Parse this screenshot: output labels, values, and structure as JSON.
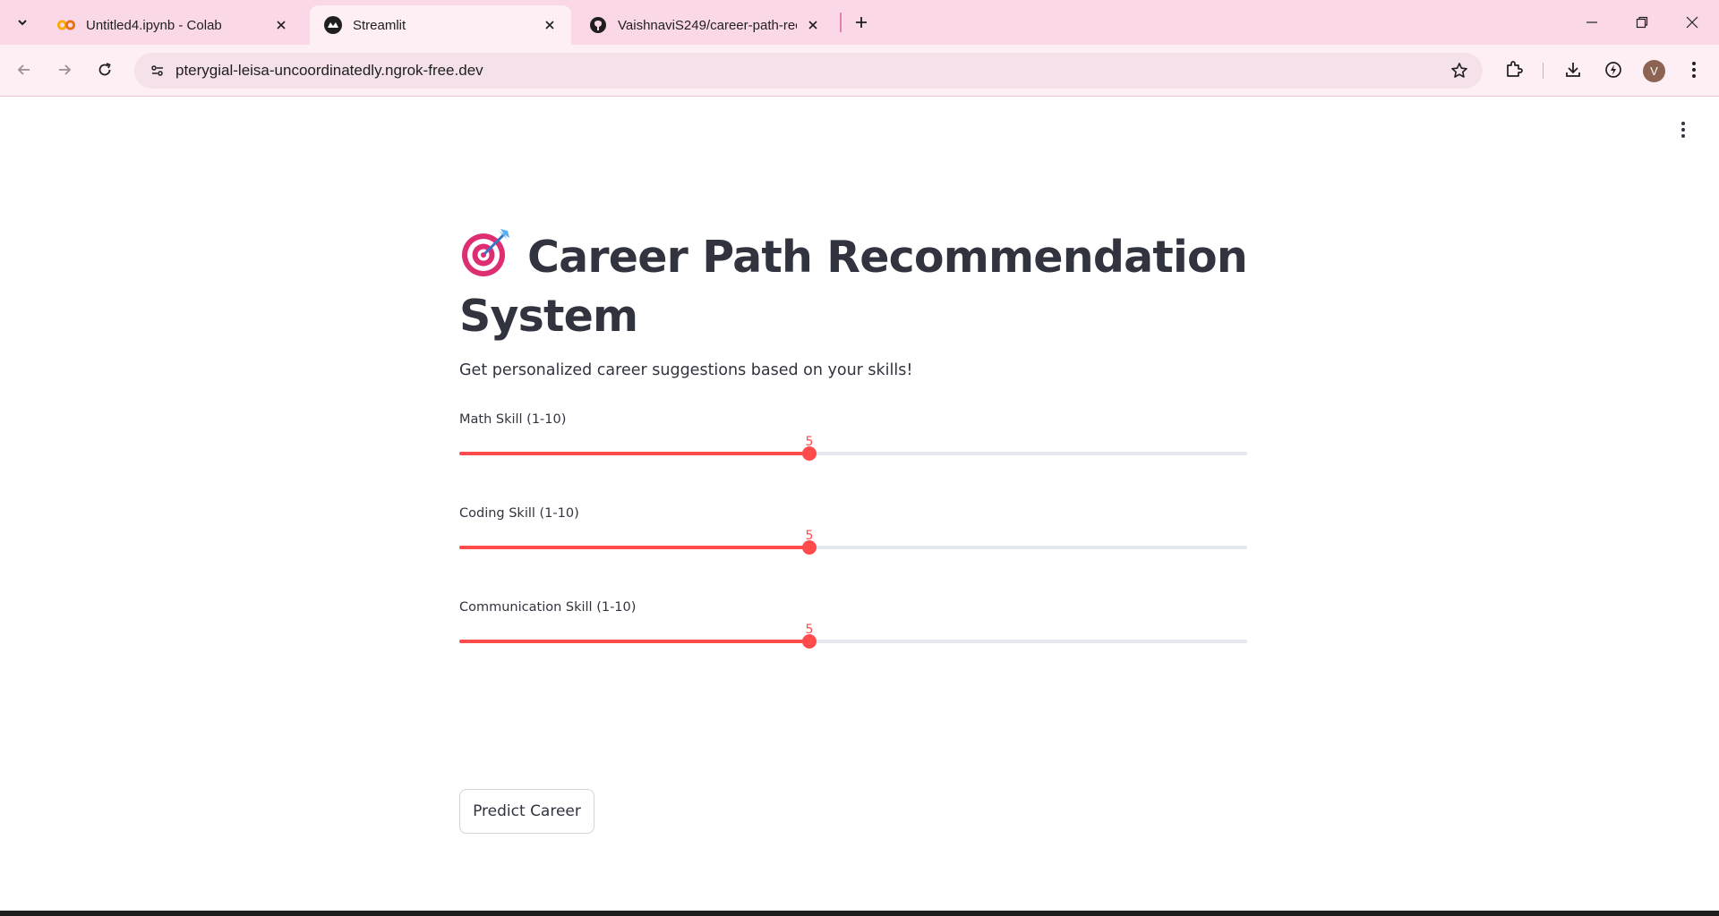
{
  "browser": {
    "tabs": [
      {
        "title": "Untitled4.ipynb - Colab",
        "icon": "colab-icon",
        "active": false
      },
      {
        "title": "Streamlit",
        "icon": "streamlit-icon",
        "active": true
      },
      {
        "title": "VaishnaviS249/career-path-reco",
        "icon": "github-icon",
        "active": false
      }
    ],
    "url": "pterygial-leisa-uncoordinatedly.ngrok-free.dev",
    "avatar_initial": "V"
  },
  "app": {
    "title": "Career Path Recommendation System",
    "title_icon": "target-icon",
    "subtitle": "Get personalized career suggestions based on your skills!",
    "sliders": [
      {
        "label": "Math Skill (1-10)",
        "value": "5",
        "fraction": 0.444
      },
      {
        "label": "Coding Skill (1-10)",
        "value": "5",
        "fraction": 0.444
      },
      {
        "label": "Communication Skill (1-10)",
        "value": "5",
        "fraction": 0.444
      }
    ],
    "button_label": "Predict Career"
  },
  "colors": {
    "accent": "#ff4b4b",
    "text": "#31333f",
    "tabstrip": "#fbd8e8",
    "toolbar": "#fdeff4"
  }
}
